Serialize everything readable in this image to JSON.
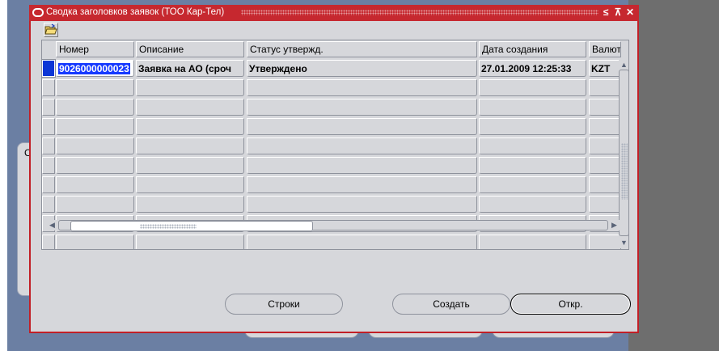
{
  "window": {
    "title": "Сводка заголовков заявок (ТОО Кар-Тел)",
    "controls": [
      "≤",
      "⊼",
      "✕"
    ]
  },
  "background": {
    "panel_letter": "С"
  },
  "table": {
    "columns": [
      "Номер",
      "Описание",
      "Статус утвержд.",
      "Дата создания",
      "Валют"
    ],
    "rows": [
      {
        "number": "9026000000023",
        "description": "Заявка на АО (сроч",
        "status": "Утверждено",
        "created": "27.01.2009 12:25:33",
        "currency": "KZT"
      }
    ],
    "empty_row_count": 9
  },
  "buttons": {
    "lines": "Строки",
    "create": "Создать",
    "open": "Откр."
  },
  "icons": {
    "toolbar": "open-folder-icon",
    "window": "oracle-logo-icon"
  },
  "colors": {
    "titlebar": "#c6282f",
    "selection": "#1539ff",
    "desktop": "#6b7fa3",
    "panel": "#d6d7db"
  }
}
